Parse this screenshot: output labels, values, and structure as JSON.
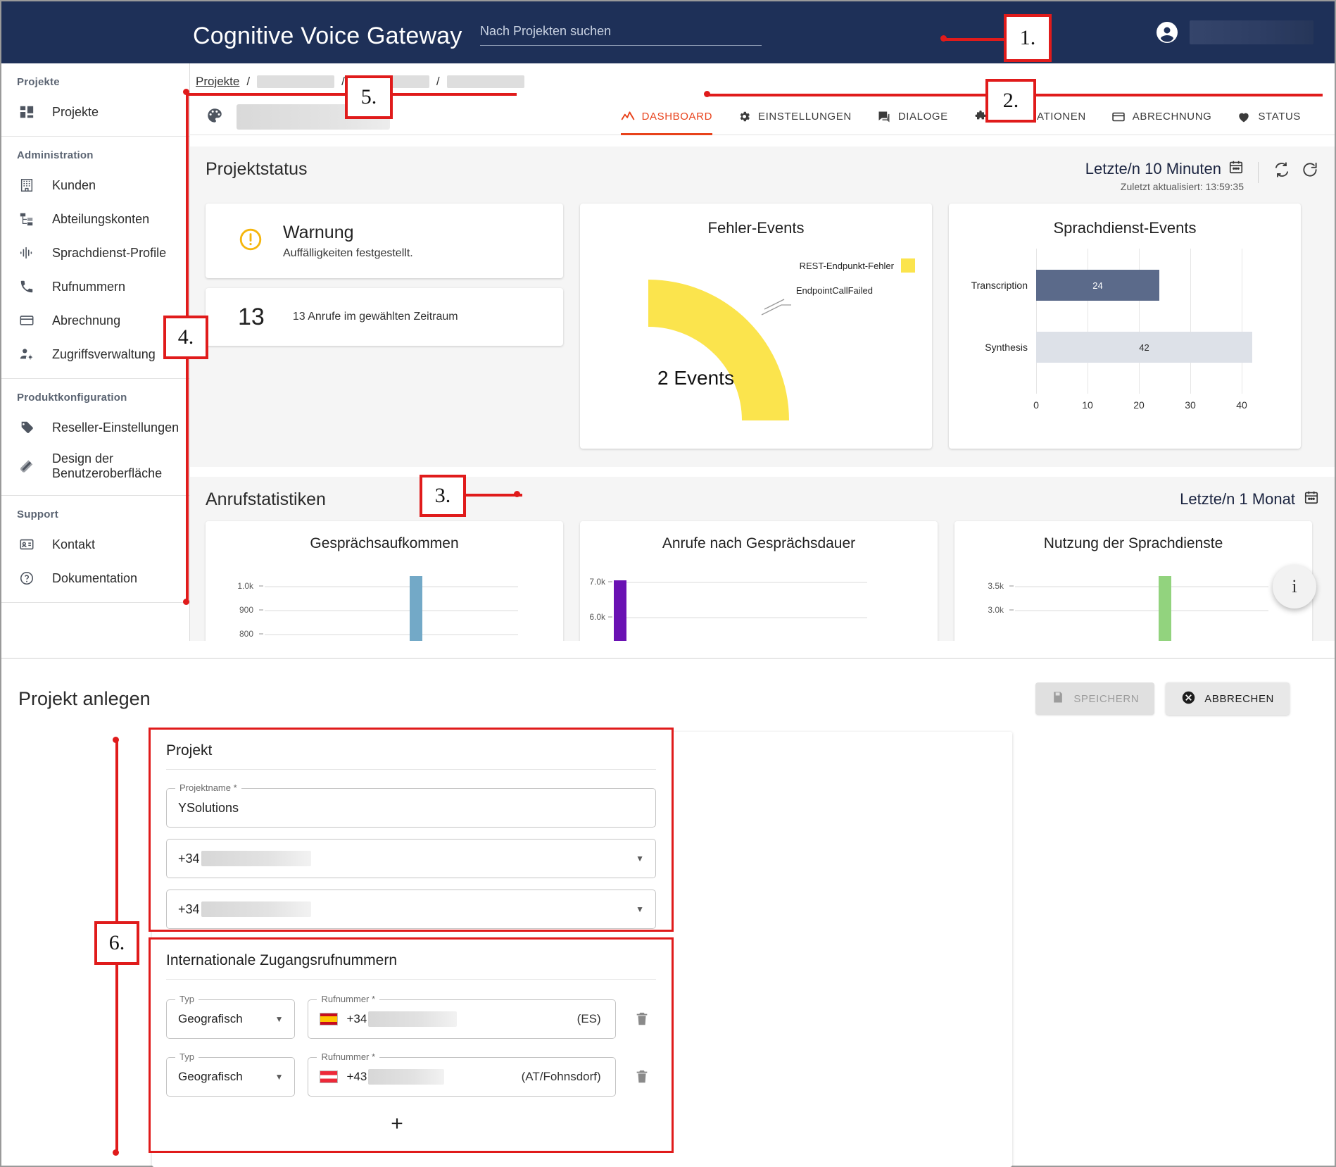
{
  "appbar": {
    "title": "Cognitive Voice Gateway",
    "search_placeholder": "Nach Projekten suchen",
    "avatar_icon": "account-circle-icon"
  },
  "sidebar": {
    "groups": [
      {
        "label": "Projekte",
        "items": [
          {
            "label": "Projekte",
            "icon": "dashboard-grid-icon"
          }
        ]
      },
      {
        "label": "Administration",
        "items": [
          {
            "label": "Kunden",
            "icon": "building-icon"
          },
          {
            "label": "Abteilungskonten",
            "icon": "org-tree-icon"
          },
          {
            "label": "Sprachdienst-Profile",
            "icon": "waveform-icon"
          },
          {
            "label": "Rufnummern",
            "icon": "phone-icon"
          },
          {
            "label": "Abrechnung",
            "icon": "credit-card-icon"
          },
          {
            "label": "Zugriffsverwaltung",
            "icon": "user-gear-icon"
          }
        ]
      },
      {
        "label": "Produktkonfiguration",
        "items": [
          {
            "label": "Reseller-Einstellungen",
            "icon": "tag-icon"
          },
          {
            "label": "Design der Benutzeroberfläche",
            "icon": "palette-layers-icon"
          }
        ]
      },
      {
        "label": "Support",
        "items": [
          {
            "label": "Kontakt",
            "icon": "contact-card-icon"
          },
          {
            "label": "Dokumentation",
            "icon": "help-circle-icon"
          }
        ]
      }
    ]
  },
  "breadcrumb": {
    "root_label": "Projekte",
    "separator": "/",
    "redacted_count": 3
  },
  "project_header": {
    "icon": "palette-icon",
    "name_redacted": true
  },
  "tabs": [
    {
      "label": "Dashboard",
      "icon": "trending-up-icon",
      "active": true
    },
    {
      "label": "Einstellungen",
      "icon": "gear-icon",
      "active": false
    },
    {
      "label": "Dialoge",
      "icon": "chat-icon",
      "active": false
    },
    {
      "label": "Integrationen",
      "icon": "puzzle-icon",
      "active": false
    },
    {
      "label": "Abrechnung",
      "icon": "credit-card-icon",
      "active": false
    },
    {
      "label": "Status",
      "icon": "heart-icon",
      "active": false
    }
  ],
  "projektstatus": {
    "title": "Projektstatus",
    "range_label": "Letzte/n 10 Minuten",
    "range_icon": "calendar-icon",
    "last_updated": "Zuletzt aktualisiert: 13:59:35",
    "sync_icon": "auto-refresh-icon",
    "refresh_icon": "refresh-icon",
    "warning": {
      "icon": "warning-circle-icon",
      "title": "Warnung",
      "subtitle": "Auffälligkeiten festgestellt.",
      "color": "#f5b60d"
    },
    "calls": {
      "value": "13",
      "text": "13 Anrufe im gewählten Zeitraum"
    }
  },
  "anrufstatistiken": {
    "title": "Anrufstatistiken",
    "range_label": "Letzte/n 1 Monat",
    "range_icon": "calendar-icon"
  },
  "info_fab": {
    "label": "i",
    "icon": "info-icon"
  },
  "chart_data": [
    {
      "type": "pie",
      "name": "fehler-events",
      "title": "Fehler-Events",
      "center_label": "2 Events",
      "total": 2,
      "legend_position": "right",
      "legend": [
        {
          "label": "REST-Endpunkt-Fehler",
          "color": "#fbe44d"
        }
      ],
      "annotations": [
        {
          "label": "EndpointCallFailed"
        }
      ],
      "slices": [
        {
          "label": "EndpointCallFailed",
          "group": "REST-Endpunkt-Fehler",
          "value": 2,
          "percent": 100,
          "color": "#fbe44d"
        }
      ]
    },
    {
      "type": "bar",
      "name": "sprachdienst-events",
      "orientation": "horizontal",
      "title": "Sprachdienst-Events",
      "categories": [
        "Transcription",
        "Synthesis"
      ],
      "values": [
        24,
        42
      ],
      "colors": [
        "#5b6a8a",
        "#dde1e8"
      ],
      "xlabel": "",
      "ylabel": "",
      "xlim": [
        0,
        44
      ],
      "xticks": [
        0,
        10,
        20,
        30,
        40
      ],
      "grid": true
    },
    {
      "type": "bar",
      "name": "gespraechsaufkommen",
      "title": "Gesprächsaufkommen",
      "categories": [
        ""
      ],
      "values": [
        1020
      ],
      "colors": [
        "#73a9c7"
      ],
      "yticks": [
        "1.0k",
        "900",
        "800"
      ],
      "ylim": [
        750,
        1050
      ],
      "grid": true
    },
    {
      "type": "bar",
      "name": "anrufe-nach-gespraechsdauer",
      "title": "Anrufe nach Gesprächsdauer",
      "categories": [
        ""
      ],
      "values": [
        7000
      ],
      "colors": [
        "#6a11b3"
      ],
      "yticks": [
        "7.0k",
        "6.0k"
      ],
      "ylim": [
        5000,
        7200
      ],
      "grid": true
    },
    {
      "type": "bar",
      "name": "nutzung-der-sprachdienste",
      "title": "Nutzung der Sprachdienste",
      "categories": [
        ""
      ],
      "values": [
        3550
      ],
      "colors": [
        "#92d37e"
      ],
      "yticks": [
        "3.5k",
        "3.0k"
      ],
      "ylim": [
        2700,
        3650
      ],
      "grid": true
    }
  ],
  "create_project": {
    "title": "Projekt anlegen",
    "save_label": "Speichern",
    "save_icon": "save-disk-icon",
    "cancel_label": "Abbrechen",
    "cancel_icon": "cancel-circle-icon",
    "project_section": {
      "title": "Projekt",
      "name_field": {
        "legend": "Projektname *",
        "value": "YSolutions"
      },
      "selects": [
        {
          "prefix": "+34",
          "value_redacted": true,
          "caret_icon": "chevron-down-icon"
        },
        {
          "prefix": "+34",
          "value_redacted": true,
          "caret_icon": "chevron-down-icon"
        }
      ]
    },
    "intl_section": {
      "title": "Internationale Zugangsrufnummern",
      "rows": [
        {
          "type_legend": "Typ",
          "type_value": "Geografisch",
          "number_legend": "Rufnummer *",
          "flag": "flag-es",
          "prefix": "+34",
          "suffix": "(ES)",
          "delete_icon": "trash-icon"
        },
        {
          "type_legend": "Typ",
          "type_value": "Geografisch",
          "number_legend": "Rufnummer *",
          "flag": "flag-at",
          "prefix": "+43",
          "suffix": "(AT/Fohnsdorf)",
          "delete_icon": "trash-icon"
        }
      ],
      "add_label": "+"
    }
  },
  "annotations": [
    {
      "label": "1."
    },
    {
      "label": "2."
    },
    {
      "label": "3."
    },
    {
      "label": "4."
    },
    {
      "label": "5."
    },
    {
      "label": "6."
    }
  ],
  "colors": {
    "appbar": "#1e3058",
    "accent": "#e8421b",
    "annotation": "#e01b1b",
    "warning": "#f5b60d"
  }
}
